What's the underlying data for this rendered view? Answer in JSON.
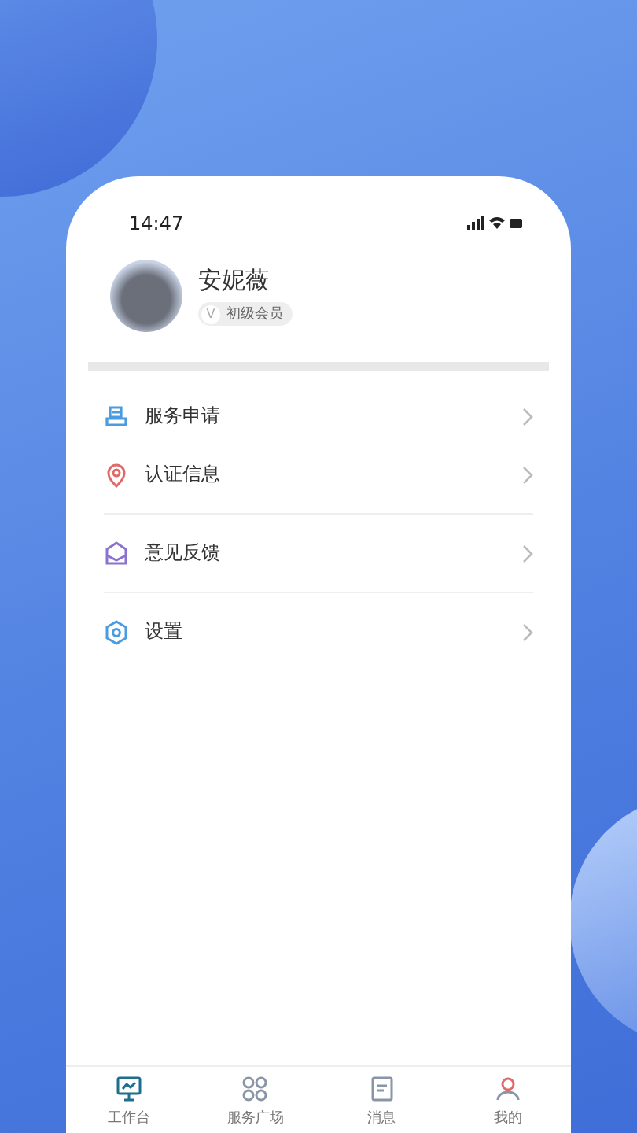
{
  "status_bar": {
    "time": "14:47"
  },
  "profile": {
    "name": "安妮薇",
    "badge_icon": "V",
    "level": "初级会员"
  },
  "menu_groups": [
    {
      "items": [
        {
          "kind": "service",
          "label": "服务申请"
        },
        {
          "kind": "location",
          "label": "认证信息"
        }
      ]
    },
    {
      "items": [
        {
          "kind": "mail",
          "label": "意见反馈"
        }
      ]
    },
    {
      "items": [
        {
          "kind": "settings",
          "label": "设置"
        }
      ]
    }
  ],
  "tab_bar": [
    {
      "kind": "monitor",
      "label": "工作台",
      "selected": true
    },
    {
      "kind": "grid",
      "label": "服务广场",
      "selected": false
    },
    {
      "kind": "message",
      "label": "消息",
      "selected": false
    },
    {
      "kind": "user",
      "label": "我的",
      "selected": false
    }
  ]
}
